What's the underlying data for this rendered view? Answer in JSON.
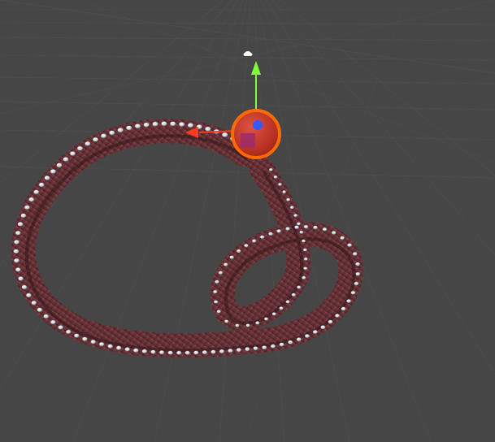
{
  "scene_view": {
    "background_color": "#464646",
    "grid_color": "#5a5a5a",
    "object": {
      "type": "tentacle",
      "skin_color": "#7a3f45",
      "sucker_color": "#cfd3d8"
    },
    "gizmo": {
      "type": "transform-gizmo",
      "x_axis_color": "#ff3b1f",
      "y_axis_color": "#7dff3a",
      "z_axis_color": "#2f5bff",
      "ring_color": "#ff6a00",
      "sphere_color": "#c73a2b",
      "light_icon": "light-icon"
    }
  }
}
